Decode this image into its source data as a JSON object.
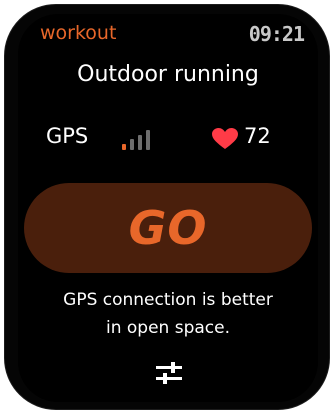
{
  "header": {
    "app_name": "workout",
    "time": "09:21"
  },
  "workout": {
    "title": "Outdoor running"
  },
  "status": {
    "gps_label": "GPS",
    "gps_signal_level": 1,
    "gps_signal_max": 4,
    "signal_active_color": "#e8672a",
    "signal_inactive_color": "#6e6e6e",
    "heart_rate": "72",
    "heart_color": "#ff3b47"
  },
  "actions": {
    "go_label": "GO",
    "go_button_color": "#4a1f0c",
    "go_text_color": "#e8672a"
  },
  "hint": {
    "line1": "GPS connection is better",
    "line2": "in open space."
  },
  "icons": {
    "settings": "sliders-icon",
    "heart": "heart-icon",
    "signal": "signal-bars-icon"
  }
}
